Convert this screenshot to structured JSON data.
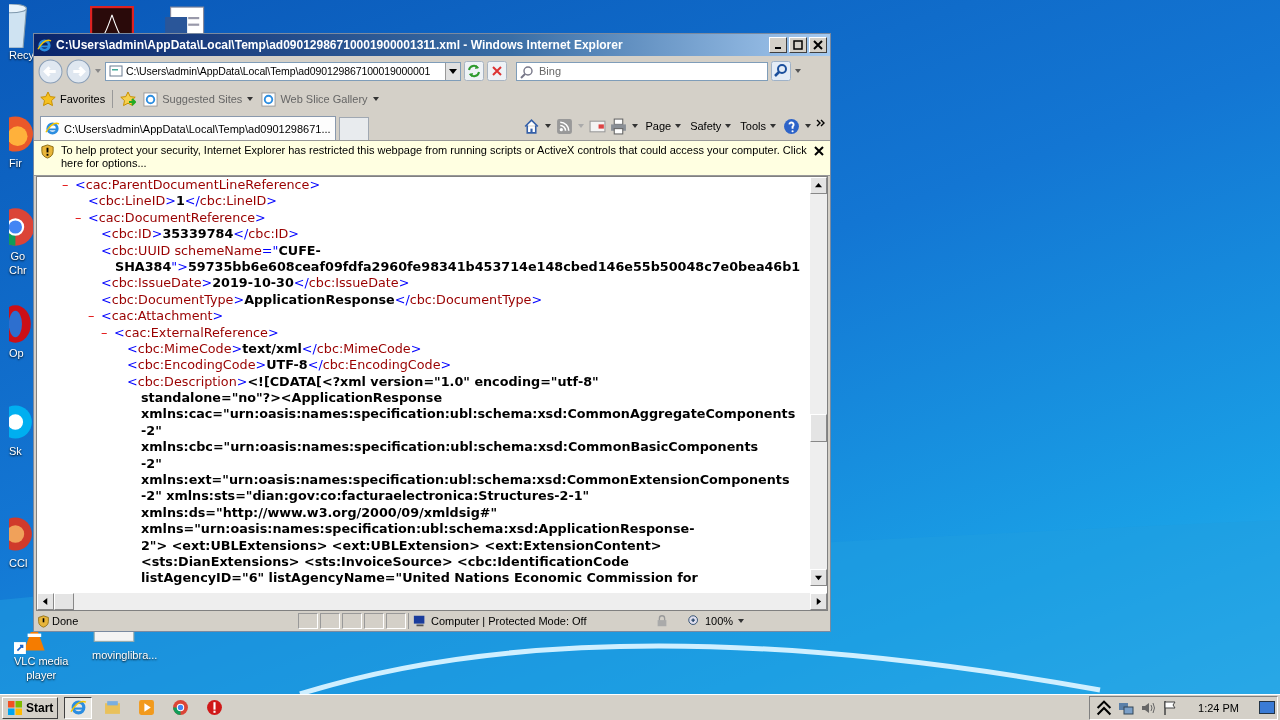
{
  "desktop_icons": [
    {
      "kind": "bin",
      "label": "Recy"
    },
    {
      "kind": "fox",
      "label": "Fir"
    },
    {
      "kind": "chrome",
      "label": "Go\nChr"
    },
    {
      "kind": "opera",
      "label": "Op"
    },
    {
      "kind": "skype",
      "label": "Sk"
    },
    {
      "kind": "cleaner",
      "label": "CCl"
    },
    {
      "kind": "cone",
      "label": "VLC media\nplayer"
    },
    {
      "kind": "file",
      "label": "movinglibra..."
    },
    {
      "kind": "pdf"
    },
    {
      "kind": "word"
    }
  ],
  "window": {
    "title": "C:\\Users\\admin\\AppData\\Local\\Temp\\ad09012986710001900001311.xml - Windows Internet Explorer",
    "address": "C:\\Users\\admin\\AppData\\Local\\Temp\\ad090129867100019000001",
    "search_placeholder": "Bing",
    "favorites_label": "Favorites",
    "favorites": [
      "Suggested Sites",
      "Web Slice Gallery"
    ],
    "tabs": [
      {
        "label": "C:\\Users\\admin\\AppData\\Local\\Temp\\ad0901298671...",
        "selected": true
      }
    ],
    "commands": [
      "Page",
      "Safety",
      "Tools"
    ],
    "info_bar": "To help protect your security, Internet Explorer has restricted this webpage from running scripts or ActiveX controls that could access your computer. Click here for options...",
    "xml": [
      {
        "toggle": "–",
        "expanded": true,
        "lines": [
          [
            {
              "kind": "mark",
              "t": "<"
            },
            {
              "kind": "name",
              "t": "cac:ParentDocumentLineReference"
            },
            {
              "kind": "mark",
              "t": ">"
            }
          ]
        ],
        "children": [
          {
            "lines": [
              [
                {
                  "kind": "mark",
                  "t": "<"
                },
                {
                  "kind": "name",
                  "t": "cbc:LineID"
                },
                {
                  "kind": "mark",
                  "t": ">"
                },
                {
                  "kind": "value",
                  "t": "1"
                },
                {
                  "kind": "mark",
                  "t": "</"
                },
                {
                  "kind": "name",
                  "t": "cbc:LineID"
                },
                {
                  "kind": "mark",
                  "t": ">"
                }
              ]
            ]
          },
          {
            "toggle": "–",
            "expanded": true,
            "lines": [
              [
                {
                  "kind": "mark",
                  "t": "<"
                },
                {
                  "kind": "name",
                  "t": "cac:DocumentReference"
                },
                {
                  "kind": "mark",
                  "t": ">"
                }
              ]
            ],
            "children": [
              {
                "lines": [
                  [
                    {
                      "kind": "mark",
                      "t": "<"
                    },
                    {
                      "kind": "name",
                      "t": "cbc:ID"
                    },
                    {
                      "kind": "mark",
                      "t": ">"
                    },
                    {
                      "kind": "value",
                      "t": "35339784"
                    },
                    {
                      "kind": "mark",
                      "t": "</"
                    },
                    {
                      "kind": "name",
                      "t": "cbc:ID"
                    },
                    {
                      "kind": "mark",
                      "t": ">"
                    }
                  ]
                ]
              },
              {
                "lines": [
                  [
                    {
                      "kind": "mark",
                      "t": "<"
                    },
                    {
                      "kind": "name",
                      "t": "cbc:UUID"
                    },
                    {
                      "kind": "attr",
                      "t": " schemeName"
                    },
                    {
                      "kind": "mark",
                      "t": "=\""
                    },
                    {
                      "kind": "value",
                      "t": "CUFE-"
                    }
                  ],
                  [
                    {
                      "kind": "value",
                      "t": "SHA384"
                    },
                    {
                      "kind": "mark",
                      "t": "\">"
                    },
                    {
                      "kind": "value",
                      "t": "59735bb6e608ceaf09fdfa2960fe98341b453714e148cbed146e55b50048c7e0bea46b1"
                    }
                  ]
                ]
              },
              {
                "lines": [
                  [
                    {
                      "kind": "mark",
                      "t": "<"
                    },
                    {
                      "kind": "name",
                      "t": "cbc:IssueDate"
                    },
                    {
                      "kind": "mark",
                      "t": ">"
                    },
                    {
                      "kind": "value",
                      "t": "2019-10-30"
                    },
                    {
                      "kind": "mark",
                      "t": "</"
                    },
                    {
                      "kind": "name",
                      "t": "cbc:IssueDate"
                    },
                    {
                      "kind": "mark",
                      "t": ">"
                    }
                  ]
                ]
              },
              {
                "lines": [
                  [
                    {
                      "kind": "mark",
                      "t": "<"
                    },
                    {
                      "kind": "name",
                      "t": "cbc:DocumentType"
                    },
                    {
                      "kind": "mark",
                      "t": ">"
                    },
                    {
                      "kind": "value",
                      "t": "ApplicationResponse"
                    },
                    {
                      "kind": "mark",
                      "t": "</"
                    },
                    {
                      "kind": "name",
                      "t": "cbc:DocumentType"
                    },
                    {
                      "kind": "mark",
                      "t": ">"
                    }
                  ]
                ]
              },
              {
                "toggle": "–",
                "expanded": true,
                "lines": [
                  [
                    {
                      "kind": "mark",
                      "t": "<"
                    },
                    {
                      "kind": "name",
                      "t": "cac:Attachment"
                    },
                    {
                      "kind": "mark",
                      "t": ">"
                    }
                  ]
                ],
                "children": [
                  {
                    "toggle": "–",
                    "expanded": true,
                    "lines": [
                      [
                        {
                          "kind": "mark",
                          "t": "<"
                        },
                        {
                          "kind": "name",
                          "t": "cac:ExternalReference"
                        },
                        {
                          "kind": "mark",
                          "t": ">"
                        }
                      ]
                    ],
                    "children": [
                      {
                        "lines": [
                          [
                            {
                              "kind": "mark",
                              "t": "<"
                            },
                            {
                              "kind": "name",
                              "t": "cbc:MimeCode"
                            },
                            {
                              "kind": "mark",
                              "t": ">"
                            },
                            {
                              "kind": "value",
                              "t": "text/xml"
                            },
                            {
                              "kind": "mark",
                              "t": "</"
                            },
                            {
                              "kind": "name",
                              "t": "cbc:MimeCode"
                            },
                            {
                              "kind": "mark",
                              "t": ">"
                            }
                          ]
                        ]
                      },
                      {
                        "lines": [
                          [
                            {
                              "kind": "mark",
                              "t": "<"
                            },
                            {
                              "kind": "name",
                              "t": "cbc:EncodingCode"
                            },
                            {
                              "kind": "mark",
                              "t": ">"
                            },
                            {
                              "kind": "value",
                              "t": "UTF-8"
                            },
                            {
                              "kind": "mark",
                              "t": "</"
                            },
                            {
                              "kind": "name",
                              "t": "cbc:EncodingCode"
                            },
                            {
                              "kind": "mark",
                              "t": ">"
                            }
                          ]
                        ]
                      },
                      {
                        "lines": [
                          [
                            {
                              "kind": "mark",
                              "t": "<"
                            },
                            {
                              "kind": "name",
                              "t": "cbc:Description"
                            },
                            {
                              "kind": "mark",
                              "t": ">"
                            },
                            {
                              "kind": "value",
                              "t": "<![CDATA[<?xml version=\"1.0\" encoding=\"utf-8\""
                            }
                          ],
                          [
                            {
                              "kind": "value",
                              "t": "standalone=\"no\"?><ApplicationResponse"
                            }
                          ],
                          [
                            {
                              "kind": "value",
                              "t": "xmlns:cac=\"urn:oasis:names:specification:ubl:schema:xsd:CommonAggregateComponents"
                            }
                          ],
                          [
                            {
                              "kind": "value",
                              "t": "-2\""
                            }
                          ],
                          [
                            {
                              "kind": "value",
                              "t": "xmlns:cbc=\"urn:oasis:names:specification:ubl:schema:xsd:CommonBasicComponents"
                            }
                          ],
                          [
                            {
                              "kind": "value",
                              "t": "-2\""
                            }
                          ],
                          [
                            {
                              "kind": "value",
                              "t": "xmlns:ext=\"urn:oasis:names:specification:ubl:schema:xsd:CommonExtensionComponents"
                            }
                          ],
                          [
                            {
                              "kind": "value",
                              "t": "-2\" xmlns:sts=\"dian:gov:co:facturaelectronica:Structures-2-1\""
                            }
                          ],
                          [
                            {
                              "kind": "value",
                              "t": "xmlns:ds=\"http://www.w3.org/2000/09/xmldsig#\""
                            }
                          ],
                          [
                            {
                              "kind": "value",
                              "t": "xmlns=\"urn:oasis:names:specification:ubl:schema:xsd:ApplicationResponse-"
                            }
                          ],
                          [
                            {
                              "kind": "value",
                              "t": "2\"> <ext:UBLExtensions> <ext:UBLExtension> <ext:ExtensionContent>"
                            }
                          ],
                          [
                            {
                              "kind": "value",
                              "t": "<sts:DianExtensions> <sts:InvoiceSource> <cbc:IdentificationCode"
                            }
                          ],
                          [
                            {
                              "kind": "value",
                              "t": "listAgencyID=\"6\" listAgencyName=\"United Nations Economic Commission for"
                            }
                          ]
                        ]
                      }
                    ]
                  }
                ]
              }
            ]
          }
        ]
      }
    ],
    "status": {
      "text": "Done",
      "zone": "Computer | Protected Mode: Off",
      "zoom": "100%"
    }
  },
  "taskbar": {
    "start": "Start",
    "items": [
      {
        "kind": "browser",
        "selected": true
      },
      {
        "kind": "folder",
        "selected": false
      },
      {
        "kind": "media",
        "selected": false
      },
      {
        "kind": "chrome",
        "selected": false
      },
      {
        "kind": "alert",
        "selected": false
      }
    ],
    "clock": "1:24 PM"
  }
}
